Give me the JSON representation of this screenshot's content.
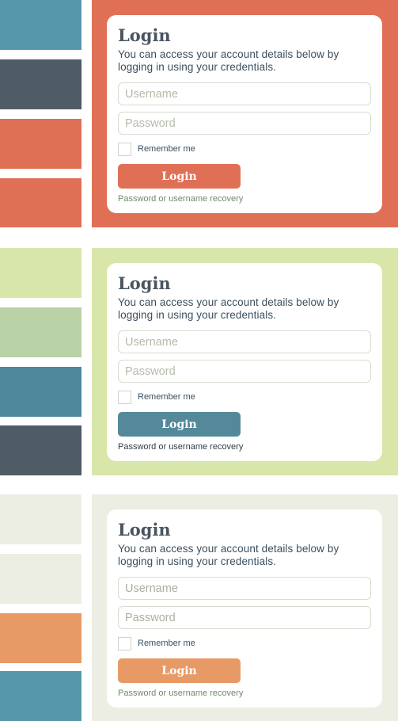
{
  "themes": [
    {
      "swatch_colors": [
        "#5797ac",
        "#4f5c66",
        "#e07055",
        "#e07055"
      ],
      "panel_color": "#e07055",
      "login": {
        "title": "Login",
        "description": "You can access your account details below by logging in using your credentials.",
        "username_placeholder": "Username",
        "password_placeholder": "Password",
        "remember_label": "Remember me",
        "button_label": "Login",
        "recovery_link": "Password or username recovery"
      }
    },
    {
      "swatch_colors": [
        "#d8e6a9",
        "#b9d2a6",
        "#4f889c",
        "#4f5c66"
      ],
      "panel_color": "#d8e6a9",
      "login": {
        "title": "Login",
        "description": "You can access your account details below by logging in using your credentials.",
        "username_placeholder": "Username",
        "password_placeholder": "Password",
        "remember_label": "Remember me",
        "button_label": "Login",
        "recovery_link": "Password or username recovery"
      }
    },
    {
      "swatch_colors": [
        "#eceee4",
        "#eceee4",
        "#e89a66",
        "#5797ac"
      ],
      "panel_color": "#eceee4",
      "login": {
        "title": "Login",
        "description": "You can access your account details below by logging in using your credentials.",
        "username_placeholder": "Username",
        "password_placeholder": "Password",
        "remember_label": "Remember me",
        "button_label": "Login",
        "recovery_link": "Password or username recovery"
      }
    }
  ]
}
